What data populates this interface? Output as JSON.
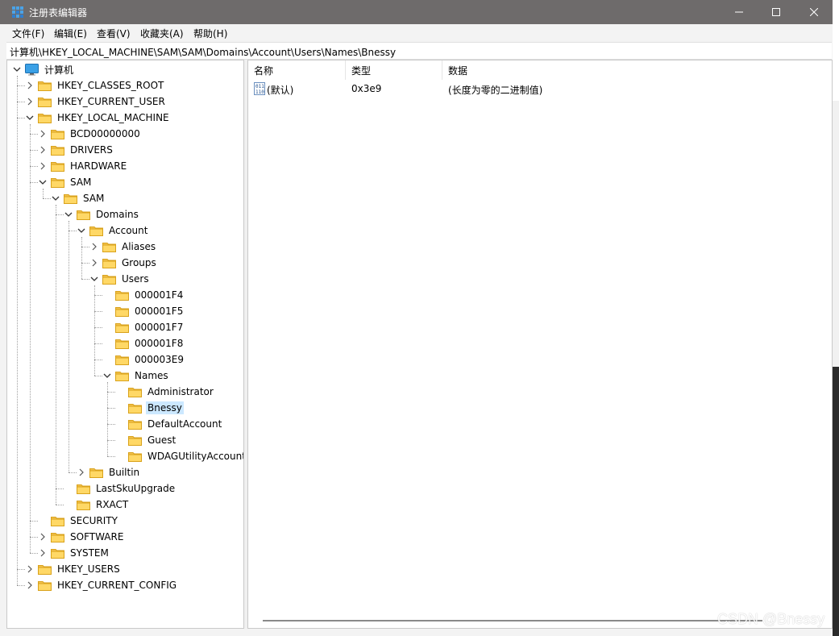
{
  "window": {
    "title": "注册表编辑器",
    "minimize": "—",
    "maximize": "☐",
    "close": "✕"
  },
  "menu": [
    "文件(F)",
    "编辑(E)",
    "查看(V)",
    "收藏夹(A)",
    "帮助(H)"
  ],
  "address": "计算机\\HKEY_LOCAL_MACHINE\\SAM\\SAM\\Domains\\Account\\Users\\Names\\Bnessy",
  "tree": [
    {
      "label": "计算机",
      "level": 0,
      "state": "expanded",
      "icon": "computer-icon"
    },
    {
      "label": "HKEY_CLASSES_ROOT",
      "level": 1,
      "state": "collapsed"
    },
    {
      "label": "HKEY_CURRENT_USER",
      "level": 1,
      "state": "collapsed"
    },
    {
      "label": "HKEY_LOCAL_MACHINE",
      "level": 1,
      "state": "expanded"
    },
    {
      "label": "BCD00000000",
      "level": 2,
      "state": "collapsed"
    },
    {
      "label": "DRIVERS",
      "level": 2,
      "state": "collapsed"
    },
    {
      "label": "HARDWARE",
      "level": 2,
      "state": "collapsed"
    },
    {
      "label": "SAM",
      "level": 2,
      "state": "expanded"
    },
    {
      "label": "SAM",
      "level": 3,
      "state": "expanded"
    },
    {
      "label": "Domains",
      "level": 4,
      "state": "expanded"
    },
    {
      "label": "Account",
      "level": 5,
      "state": "expanded"
    },
    {
      "label": "Aliases",
      "level": 6,
      "state": "collapsed"
    },
    {
      "label": "Groups",
      "level": 6,
      "state": "collapsed"
    },
    {
      "label": "Users",
      "level": 6,
      "state": "expanded"
    },
    {
      "label": "000001F4",
      "level": 7,
      "state": "leaf"
    },
    {
      "label": "000001F5",
      "level": 7,
      "state": "leaf"
    },
    {
      "label": "000001F7",
      "level": 7,
      "state": "leaf"
    },
    {
      "label": "000001F8",
      "level": 7,
      "state": "leaf"
    },
    {
      "label": "000003E9",
      "level": 7,
      "state": "leaf"
    },
    {
      "label": "Names",
      "level": 7,
      "state": "expanded"
    },
    {
      "label": "Administrator",
      "level": 8,
      "state": "leaf"
    },
    {
      "label": "Bnessy",
      "level": 8,
      "state": "leaf",
      "selected": true
    },
    {
      "label": "DefaultAccount",
      "level": 8,
      "state": "leaf"
    },
    {
      "label": "Guest",
      "level": 8,
      "state": "leaf"
    },
    {
      "label": "WDAGUtilityAccount",
      "level": 8,
      "state": "leaf"
    },
    {
      "label": "Builtin",
      "level": 5,
      "state": "collapsed"
    },
    {
      "label": "LastSkuUpgrade",
      "level": 4,
      "state": "leaf"
    },
    {
      "label": "RXACT",
      "level": 4,
      "state": "leaf"
    },
    {
      "label": "SECURITY",
      "level": 2,
      "state": "leaf"
    },
    {
      "label": "SOFTWARE",
      "level": 2,
      "state": "collapsed"
    },
    {
      "label": "SYSTEM",
      "level": 2,
      "state": "collapsed"
    },
    {
      "label": "HKEY_USERS",
      "level": 1,
      "state": "collapsed"
    },
    {
      "label": "HKEY_CURRENT_CONFIG",
      "level": 1,
      "state": "collapsed"
    }
  ],
  "list": {
    "columns": [
      "名称",
      "类型",
      "数据"
    ],
    "rows": [
      {
        "name": "(默认)",
        "type": "0x3e9",
        "data": "(长度为零的二进制值)",
        "icon": "binary-value-icon"
      }
    ]
  },
  "watermark": "CSDN @Bnessy",
  "colors": {
    "titlebar": "#6e6b6b",
    "folder": "#f5c542",
    "selection": "#cce8ff"
  }
}
